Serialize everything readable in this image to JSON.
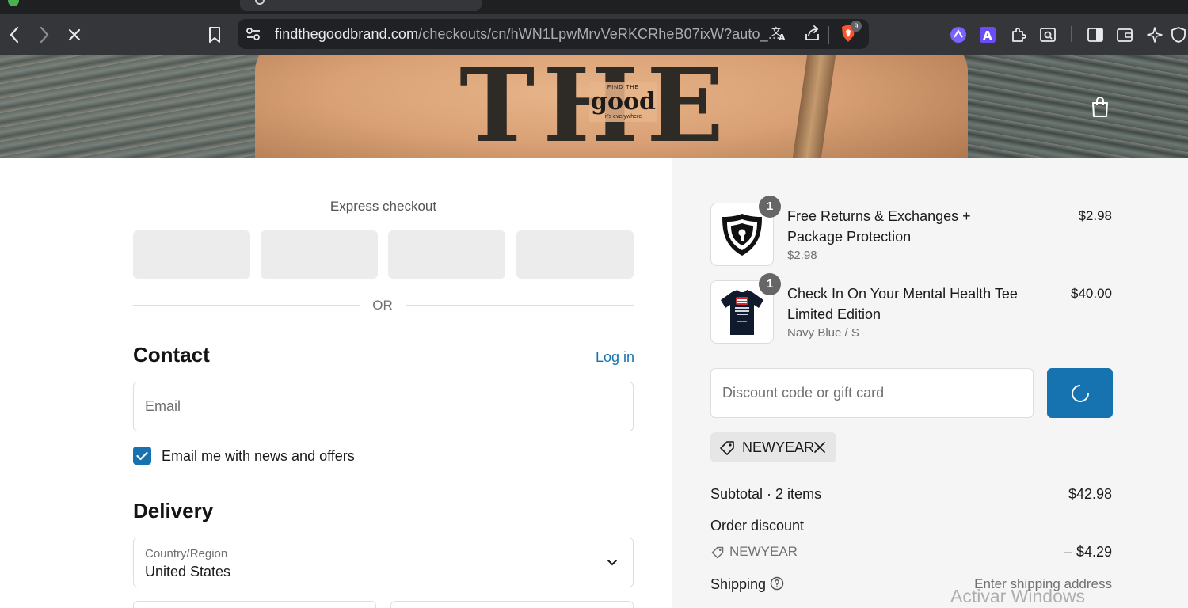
{
  "browser": {
    "url_domain": "findthegoodbrand.com",
    "url_path": "/checkouts/cn/hWN1LpwMrvVeRKCRheB07ixW?auto_...",
    "shields_count": "9",
    "colors": {
      "chrome": "#35363a",
      "omnibox": "#202124",
      "tabstrip": "#1f2022"
    }
  },
  "hero": {
    "shirt_text": "THE",
    "logo_top": "FIND THE",
    "logo_main": "good",
    "logo_bottom": "it's everywhere"
  },
  "express": {
    "title": "Express checkout",
    "divider": "OR"
  },
  "contact": {
    "heading": "Contact",
    "login_link": "Log in",
    "email_placeholder": "Email",
    "newsletter_label": "Email me with news and offers",
    "newsletter_checked": true
  },
  "delivery": {
    "heading": "Delivery",
    "country_label": "Country/Region",
    "country_value": "United States"
  },
  "summary": {
    "items": [
      {
        "qty": "1",
        "name": "Free Returns & Exchanges + Package Protection",
        "sub": "$2.98",
        "price": "$2.98",
        "icon": "lock-shield-icon"
      },
      {
        "qty": "1",
        "name": "Check In On Your Mental Health Tee Limited Edition",
        "sub": "Navy Blue / S",
        "price": "$40.00",
        "icon": "tshirt-icon"
      }
    ],
    "discount_placeholder": "Discount code or gift card",
    "applied_code": "NEWYEAR",
    "subtotal_label": "Subtotal · 2 items",
    "subtotal_value": "$42.98",
    "order_discount_label": "Order discount",
    "order_discount_code": "NEWYEAR",
    "order_discount_value": "– $4.29",
    "shipping_label": "Shipping",
    "shipping_value": "Enter shipping address",
    "accent": "#1773b0"
  },
  "os": {
    "watermark": "Activar Windows"
  }
}
